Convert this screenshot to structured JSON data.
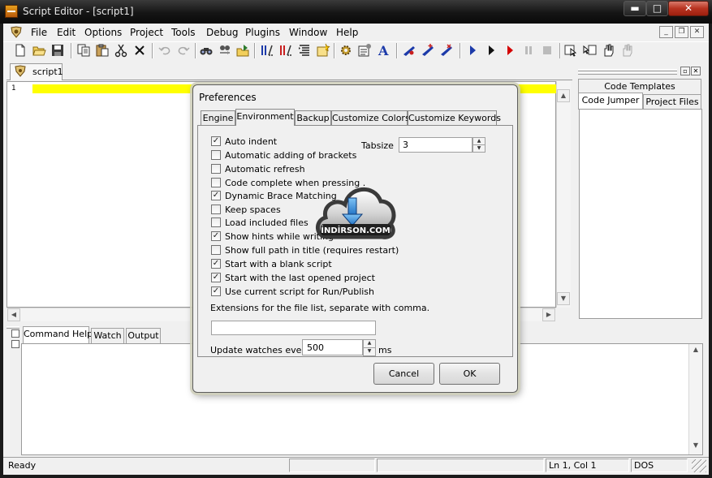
{
  "window": {
    "title": "Script Editor - [script1]",
    "min_glyph": "▬",
    "max_glyph": "□",
    "close_glyph": "✕"
  },
  "menu": {
    "items": [
      "File",
      "Edit",
      "Options",
      "Project",
      "Tools",
      "Debug",
      "Plugins",
      "Window",
      "Help"
    ],
    "mdi_min": "_",
    "mdi_restore": "❐",
    "mdi_close": "✕"
  },
  "toolbar": {
    "icons": [
      "new-file-icon",
      "open-folder-icon",
      "save-icon",
      "copy-icon",
      "paste-icon",
      "cut-icon",
      "delete-icon",
      "undo-icon",
      "redo-icon",
      "find-icon",
      "find-in-files-icon",
      "goto-icon",
      "compile-icon",
      "check-syntax-icon",
      "format-code-icon",
      "open-script-icon",
      "settings-gear-icon",
      "properties-icon",
      "font-icon",
      "toggle-breakpoint-icon",
      "add-watch-icon",
      "remove-watch-icon",
      "run-icon",
      "step-icon",
      "run-to-cursor-icon",
      "pause-icon",
      "stop-icon",
      "help-cursor-icon",
      "context-help-icon",
      "drag-hand-icon",
      "disabled-hand-icon"
    ]
  },
  "editor": {
    "tab_label": "script1",
    "line_number": "1"
  },
  "right_panel": {
    "tabs": {
      "code_templates": "Code Templates",
      "code_jumper": "Code Jumper",
      "project_files": "Project Files"
    },
    "pin_glyph": "▫",
    "close_glyph": "✕"
  },
  "bottom_panel": {
    "tabs": {
      "command_help": "Command Help",
      "watch": "Watch",
      "output": "Output"
    }
  },
  "statusbar": {
    "state": "Ready",
    "position": "Ln 1, Col 1",
    "line_endings": "DOS"
  },
  "dialog": {
    "title": "Preferences",
    "tabs": {
      "engine": "Engine",
      "environment": "Environment",
      "backup": "Backup",
      "customize_colors": "Customize Colors",
      "customize_keywords": "Customize Keywords"
    },
    "options": [
      {
        "label": "Auto indent",
        "checked": true
      },
      {
        "label": "Automatic adding of brackets",
        "checked": false
      },
      {
        "label": "Automatic refresh",
        "checked": false
      },
      {
        "label": "Code complete when pressing .",
        "checked": false
      },
      {
        "label": "Dynamic Brace Matching",
        "checked": true
      },
      {
        "label": "Keep spaces",
        "checked": false
      },
      {
        "label": "Load included files",
        "checked": false
      },
      {
        "label": "Show hints while writing",
        "checked": true
      },
      {
        "label": "Show full path in title (requires restart)",
        "checked": false
      },
      {
        "label": "Start with a blank script",
        "checked": true
      },
      {
        "label": "Start with the last opened project",
        "checked": true
      },
      {
        "label": "Use current script for Run/Publish",
        "checked": true
      }
    ],
    "tabsize_label": "Tabsize",
    "tabsize_value": "3",
    "extensions_label": "Extensions for the file list, separate with comma.",
    "extensions_value": "",
    "watch_label": "Update watches every",
    "watch_value": "500",
    "watch_unit": "ms",
    "cancel_label": "Cancel",
    "ok_label": "OK"
  },
  "watermark": {
    "text": "İNDİRSON.COM"
  },
  "colors": {
    "current_line": "#ffff00",
    "title_bar": "#151515",
    "close_button": "#b83320",
    "run_blue": "#1c3aa9",
    "stop_red": "#d40000"
  }
}
